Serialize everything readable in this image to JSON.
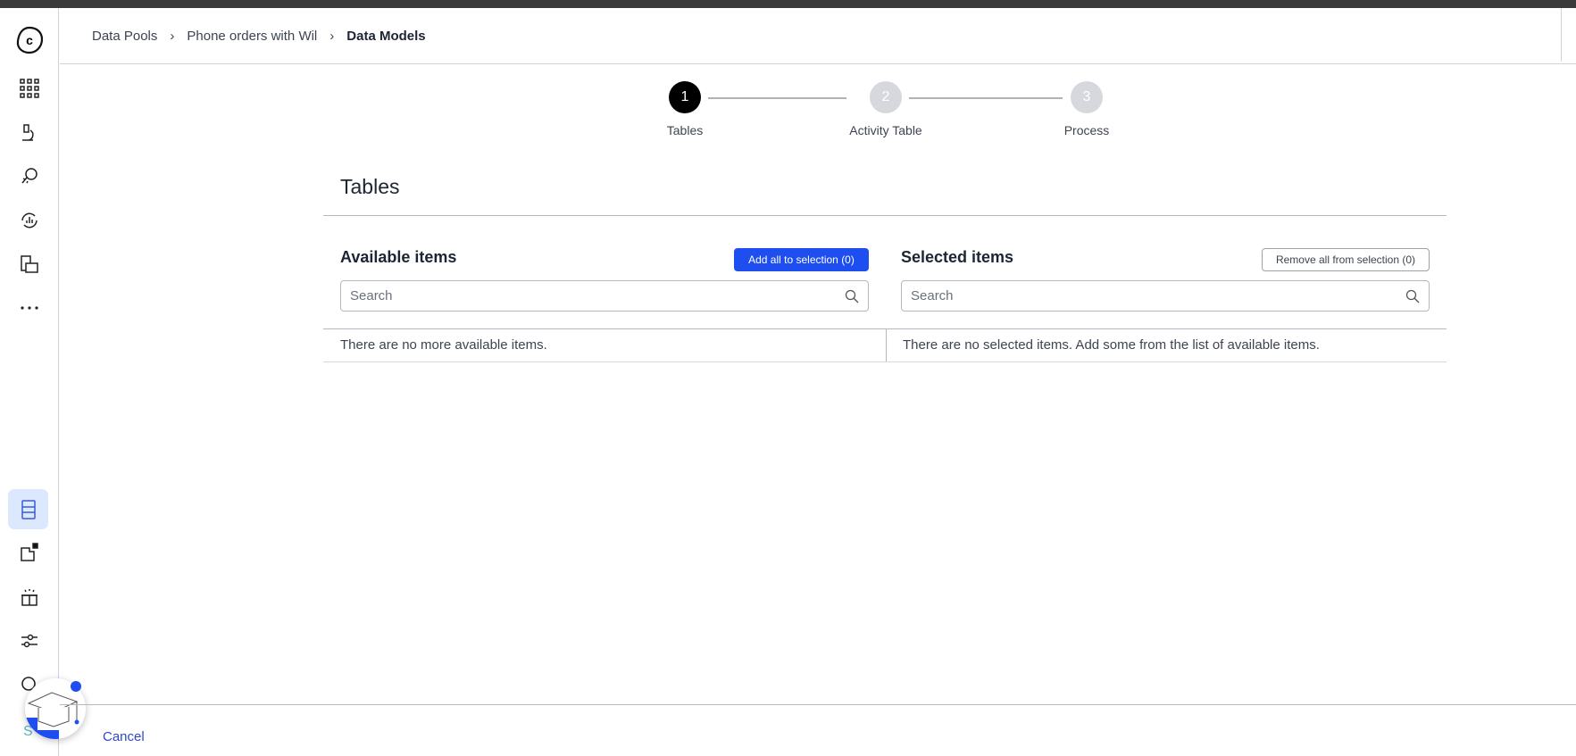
{
  "breadcrumb": [
    "Data Pools",
    "Phone orders with Wil",
    "Data Models"
  ],
  "stepper": [
    {
      "num": "1",
      "label": "Tables",
      "state": "current"
    },
    {
      "num": "2",
      "label": "Activity Table",
      "state": "pending"
    },
    {
      "num": "3",
      "label": "Process",
      "state": "pending"
    }
  ],
  "page_title": "Tables",
  "available": {
    "heading": "Available items",
    "button": "Add all to selection (0)",
    "search_placeholder": "Search",
    "empty": "There are no more available items."
  },
  "selected": {
    "heading": "Selected items",
    "button": "Remove all from selection (0)",
    "search_placeholder": "Search",
    "empty": "There are no selected items. Add some from the list of available items."
  },
  "footer": {
    "cancel": "Cancel",
    "partial_label": "S"
  },
  "colors": {
    "accent": "#1e4ef0",
    "active_nav": "#dbe8fd"
  }
}
